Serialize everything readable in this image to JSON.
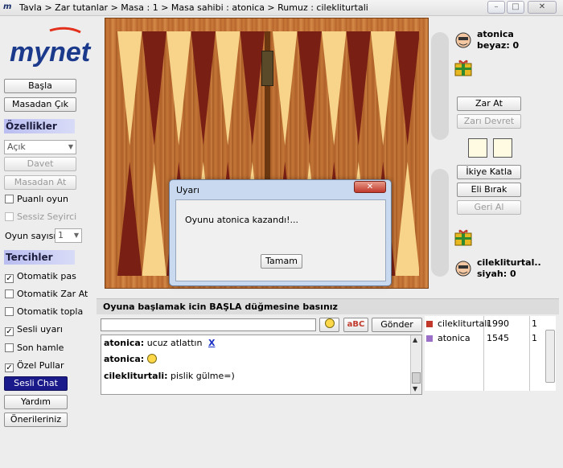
{
  "window": {
    "title": "Tavla > Zar tutanlar > Masa : 1 > Masa sahibi : atonica > Rumuz : cilekliturtali",
    "minimize_label": "–",
    "maximize_label": "□",
    "close_label": "✕"
  },
  "brand": {
    "logo_text": "mynet",
    "logo_color": "#1c3a8c",
    "logo_accent": "#e3301c"
  },
  "left_panel": {
    "start_button": "Başla",
    "leave_button": "Masadan Çık",
    "features_header": "Özellikler",
    "table_status_select": "Açık",
    "invite_button": "Davet",
    "remove_button": "Masadan At",
    "rated_game_label": "Puanlı oyun",
    "silent_spectator_label": "Sessiz Seyirci",
    "game_count_label": "Oyun sayısı",
    "game_count_value": "1",
    "prefs_header": "Tercihler",
    "auto_pass_label": "Otomatik pas",
    "auto_roll_label": "Otomatik Zar At",
    "auto_collect_label": "Otomatik topla",
    "sound_warning_label": "Sesli uyarı",
    "last_move_label": "Son hamle",
    "special_pieces_label": "Özel Pullar",
    "voice_chat_button": "Sesli Chat",
    "help_button": "Yardım",
    "suggestions_button": "Önerileriniz"
  },
  "right_panel": {
    "player1_name": "atonica",
    "player1_score": "beyaz: 0",
    "player2_name": "cilekliturtal..",
    "player2_score": "siyah:  0",
    "roll_button": "Zar At",
    "pass_dice_button": "Zarı Devret",
    "double_button": "İkiye Katla",
    "resign_button": "Eli Bırak",
    "undo_button": "Geri Al"
  },
  "dialog": {
    "title": "Uyarı",
    "message": "Oyunu atonica kazandı!...",
    "ok_button": "Tamam",
    "close_label": "✕"
  },
  "status_bar": {
    "text": "Oyuna başlamak icin BAŞLA düğmesine basınız"
  },
  "chat": {
    "send_button": "Gönder",
    "spell_button": "aBC",
    "messages": [
      {
        "who": "atonica:",
        "text": "ucuz atlattın",
        "action": "X"
      },
      {
        "who": "atonica:",
        "text": ""
      },
      {
        "who": "cilekliturtali:",
        "text": "pislik gülme=)"
      }
    ]
  },
  "player_list": [
    {
      "name": "cilekliturtali",
      "score": "1990",
      "count": "1",
      "color": "#c0392b"
    },
    {
      "name": "atonica",
      "score": "1545",
      "count": "1",
      "color": "#9b6fc8"
    }
  ],
  "colors": {
    "board_dark_point": "#7a1f14",
    "board_light_point": "#f7d48a",
    "dialog_frame": "#c9daf0"
  }
}
